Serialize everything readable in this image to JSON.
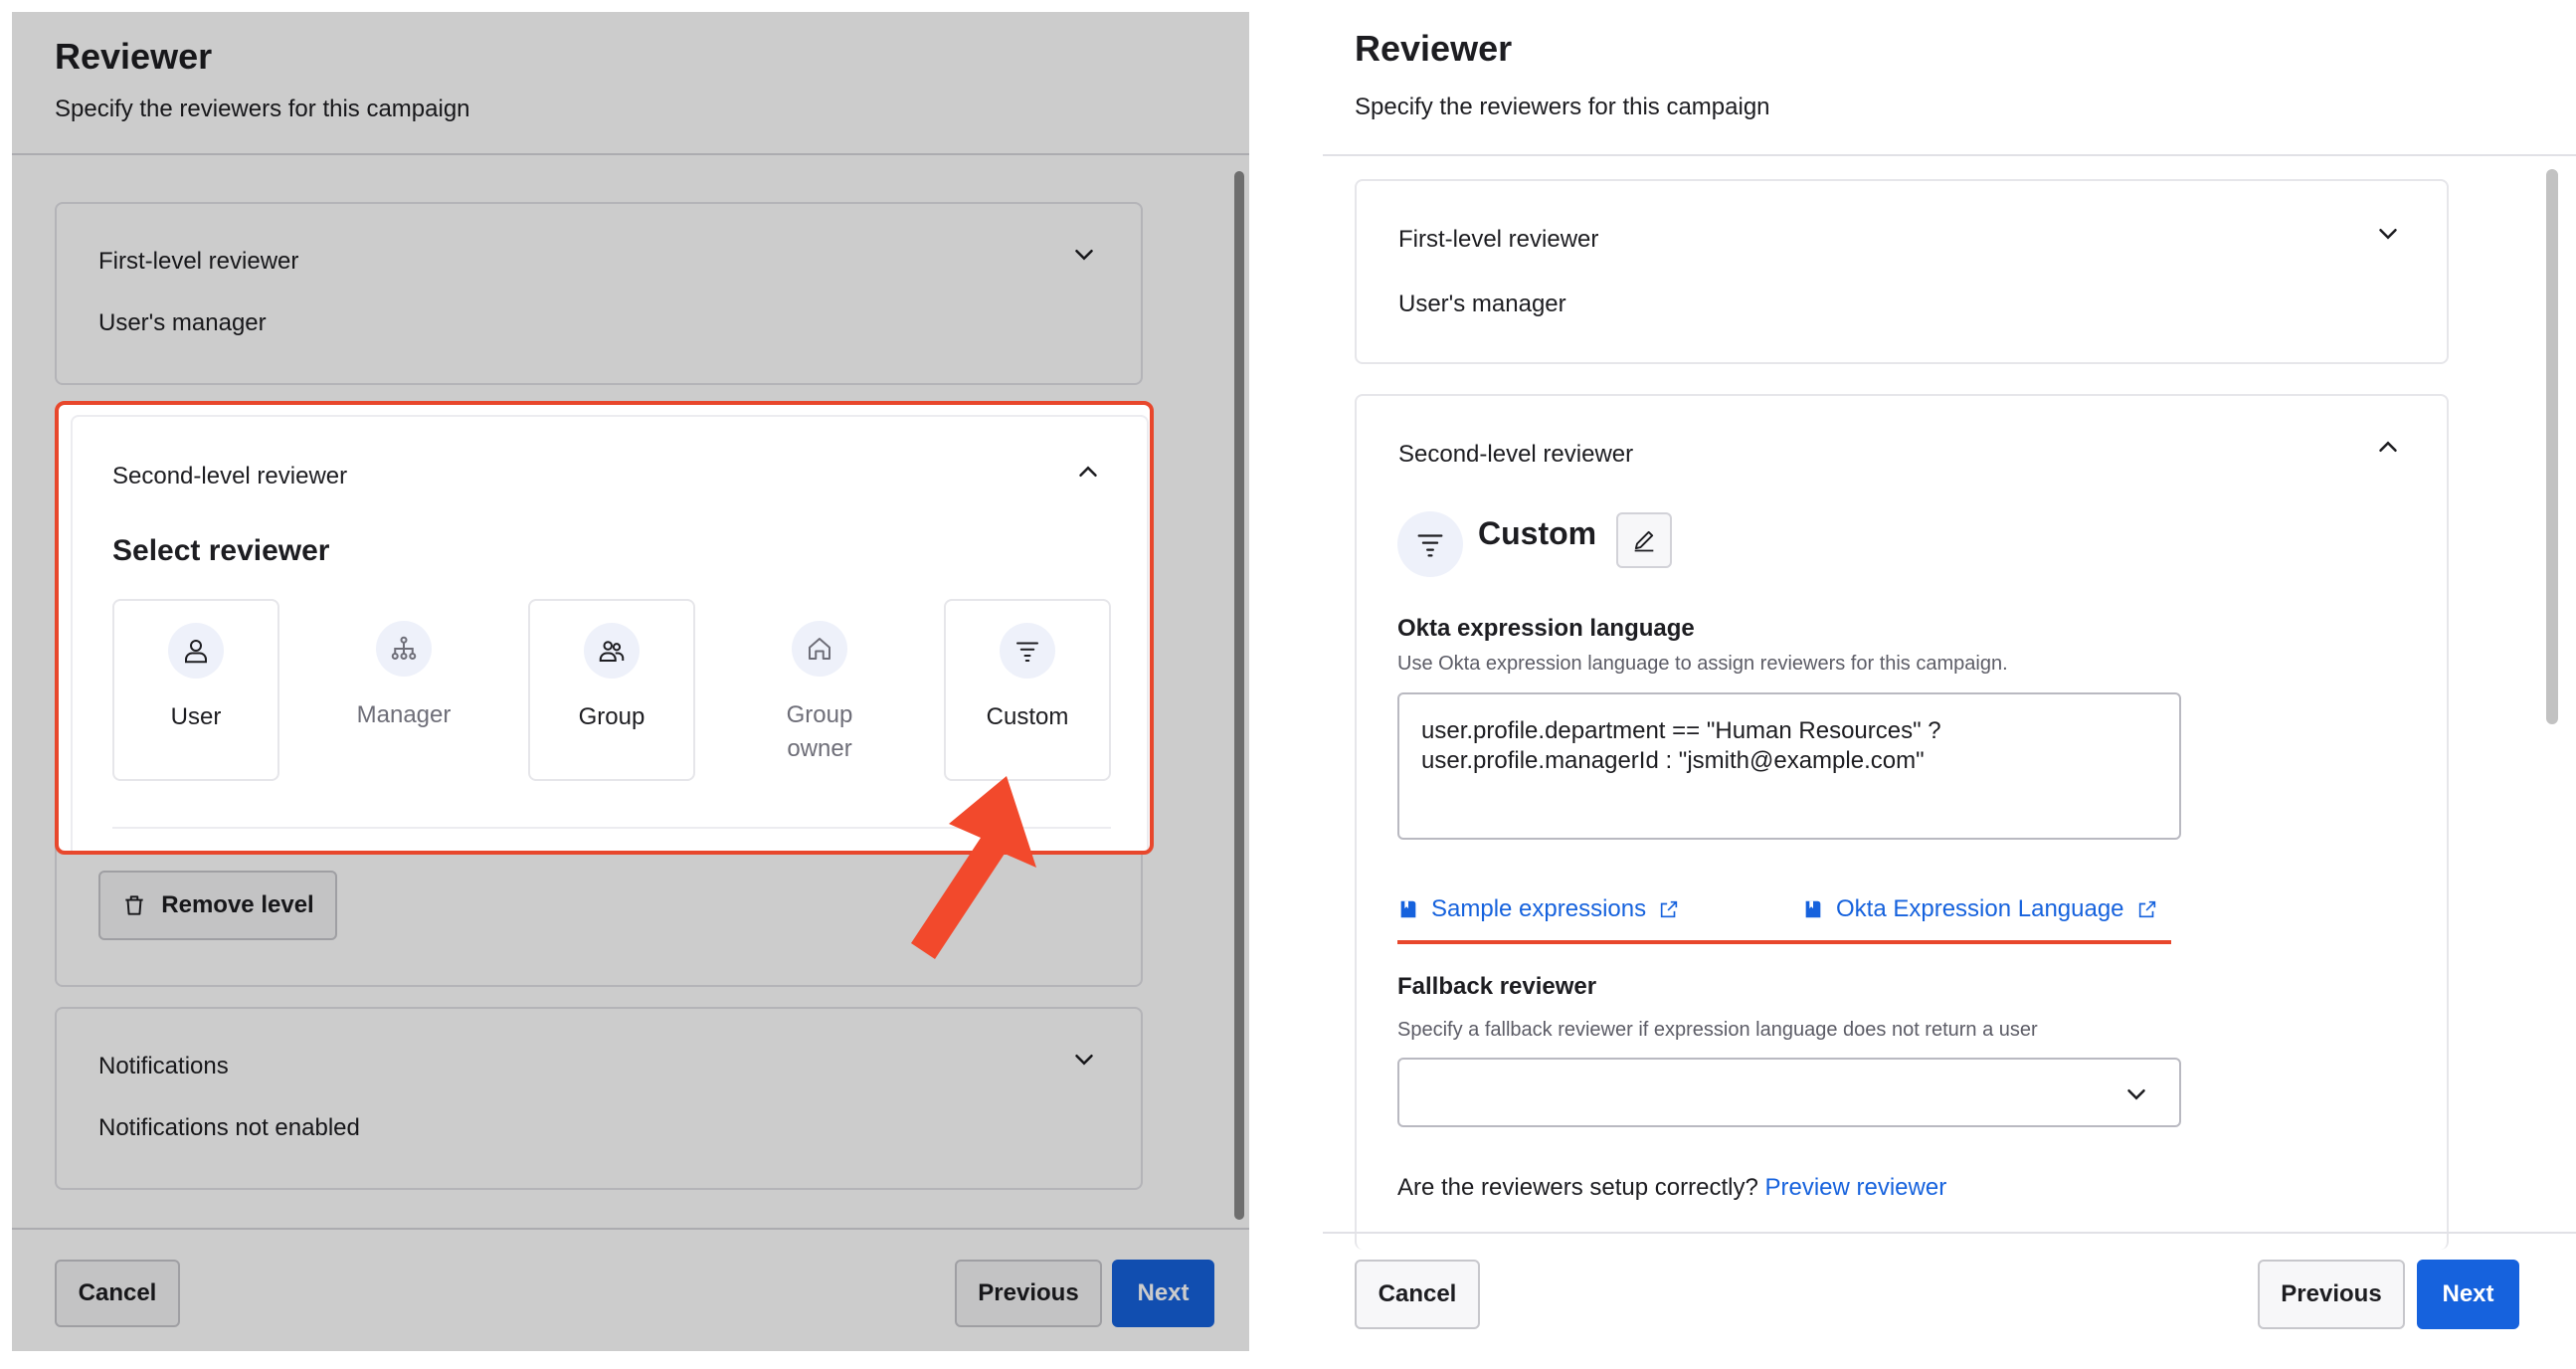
{
  "left_panel": {
    "header": {
      "title": "Reviewer",
      "subtitle": "Specify the reviewers for this campaign"
    },
    "first_level": {
      "title": "First-level reviewer",
      "value": "User's manager"
    },
    "second_level": {
      "title": "Second-level reviewer",
      "heading": "Select reviewer",
      "options": [
        {
          "label": "User",
          "icon": "user-icon"
        },
        {
          "label": "Manager",
          "icon": "org-chart-icon"
        },
        {
          "label": "Group",
          "icon": "group-icon"
        },
        {
          "label": "Group owner",
          "icon": "home-icon"
        },
        {
          "label": "Custom",
          "icon": "filter-icon"
        }
      ],
      "remove_label": "Remove level"
    },
    "notifications": {
      "title": "Notifications",
      "value": "Notifications not enabled"
    },
    "footer": {
      "cancel": "Cancel",
      "previous": "Previous",
      "next": "Next"
    }
  },
  "right_panel": {
    "header": {
      "title": "Reviewer",
      "subtitle": "Specify the reviewers for this campaign"
    },
    "first_level": {
      "title": "First-level reviewer",
      "value": "User's manager"
    },
    "second_level": {
      "title": "Second-level reviewer",
      "selected": "Custom",
      "expression_heading": "Okta expression language",
      "expression_description": "Use Okta expression language to assign reviewers for this campaign.",
      "expression_value": "user.profile.department == \"Human Resources\" ?\nuser.profile.managerId : \"jsmith@example.com\"",
      "links": {
        "sample": "Sample expressions",
        "okta_el": "Okta Expression Language"
      },
      "fallback_heading": "Fallback reviewer",
      "fallback_description": "Specify a fallback reviewer if expression language does not return a user",
      "fallback_value": "",
      "preview_question": "Are the reviewers setup correctly?",
      "preview_link": "Preview reviewer"
    },
    "footer": {
      "cancel": "Cancel",
      "previous": "Previous",
      "next": "Next"
    }
  },
  "colors": {
    "primary": "#1662dd",
    "highlight": "#e8472c",
    "link": "#1662dd"
  }
}
